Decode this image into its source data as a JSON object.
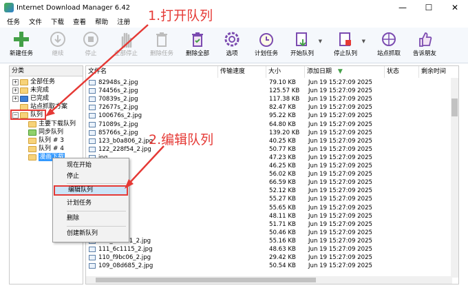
{
  "window": {
    "title": "Internet Download Manager 6.42",
    "minimize": "—",
    "maximize": "☐",
    "close": "✕"
  },
  "menu": [
    "任务",
    "文件",
    "下载",
    "查看",
    "帮助",
    "注册"
  ],
  "toolbar": [
    {
      "label": "新建任务",
      "icon": "plus-icon",
      "enabled": true
    },
    {
      "label": "继续",
      "icon": "down-arrow-icon",
      "enabled": false
    },
    {
      "label": "停止",
      "icon": "stop-icon",
      "enabled": false
    },
    {
      "label": "全部停止",
      "icon": "hand-icon",
      "enabled": false
    },
    {
      "label": "删除任务",
      "icon": "trash-icon",
      "enabled": false
    },
    {
      "label": "删除全部",
      "icon": "trash-all-icon",
      "enabled": true
    },
    {
      "label": "选项",
      "icon": "gear-icon",
      "enabled": true
    },
    {
      "label": "计划任务",
      "icon": "clock-icon",
      "enabled": true
    },
    {
      "label": "开始队列",
      "icon": "start-queue-icon",
      "enabled": true
    },
    {
      "label": "停止队列",
      "icon": "stop-queue-icon",
      "enabled": true
    },
    {
      "label": "站点抓取",
      "icon": "spider-icon",
      "enabled": true
    },
    {
      "label": "告诉朋友",
      "icon": "thumbs-up-icon",
      "enabled": true
    }
  ],
  "annotations": {
    "step1": "1.打开队列",
    "step2": "2.编辑队列"
  },
  "left_pane": {
    "header": "分类",
    "tree": [
      {
        "label": "全部任务",
        "depth": 0,
        "expander": "+",
        "folder": "yellow"
      },
      {
        "label": "未完成",
        "depth": 0,
        "expander": "+",
        "folder": "yellow"
      },
      {
        "label": "已完成",
        "depth": 0,
        "expander": "+",
        "folder": "check"
      },
      {
        "label": "站点抓取方案",
        "depth": 0,
        "expander": "",
        "folder": "yellow"
      },
      {
        "label": "队列",
        "depth": 0,
        "expander": "−",
        "folder": "yellow"
      },
      {
        "label": "主要下载队列",
        "depth": 1,
        "expander": "",
        "folder": "yellow"
      },
      {
        "label": "同步队列",
        "depth": 1,
        "expander": "",
        "folder": "green"
      },
      {
        "label": "队列 # 3",
        "depth": 1,
        "expander": "",
        "folder": "yellow"
      },
      {
        "label": "队列 # 4",
        "depth": 1,
        "expander": "",
        "folder": "yellow"
      },
      {
        "label": "漫画下载",
        "depth": 1,
        "expander": "",
        "folder": "yellow",
        "selected": true
      }
    ]
  },
  "columns": [
    "文件名",
    "传输速度",
    "大小",
    "添加日期",
    "状态",
    "剩余时间"
  ],
  "files": [
    {
      "name": "82948s_2.jpg",
      "size": "79.10  KB",
      "date": "Jun 19 15:27:09 2025"
    },
    {
      "name": "74456s_2.jpg",
      "size": "125.57  KB",
      "date": "Jun 19 15:27:09 2025"
    },
    {
      "name": "70839s_2.jpg",
      "size": "117.38  KB",
      "date": "Jun 19 15:27:09 2025"
    },
    {
      "name": "72677s_2.jpg",
      "size": "82.47  KB",
      "date": "Jun 19 15:27:09 2025"
    },
    {
      "name": "100676s_2.jpg",
      "size": "95.22  KB",
      "date": "Jun 19 15:27:09 2025"
    },
    {
      "name": "71089s_2.jpg",
      "size": "64.80  KB",
      "date": "Jun 19 15:27:09 2025"
    },
    {
      "name": "85766s_2.jpg",
      "size": "139.20  KB",
      "date": "Jun 19 15:27:09 2025"
    },
    {
      "name": "123_b0a806_2.jpg",
      "size": "40.25  KB",
      "date": "Jun 19 15:27:09 2025"
    },
    {
      "name": "122_228f54_2.jpg",
      "size": "50.77  KB",
      "date": "Jun 19 15:27:09 2025"
    },
    {
      "name": "jpg",
      "size": "47.23  KB",
      "date": "Jun 19 15:27:09 2025"
    },
    {
      "name": "jpg",
      "size": "46.25  KB",
      "date": "Jun 19 15:27:09 2025"
    },
    {
      "name": "jpg",
      "size": "56.02  KB",
      "date": "Jun 19 15:27:09 2025"
    },
    {
      "name": "jpg",
      "size": "66.59  KB",
      "date": "Jun 19 15:27:09 2025"
    },
    {
      "name": "2.jpg",
      "size": "52.12  KB",
      "date": "Jun 19 15:27:09 2025"
    },
    {
      "name": "2.jpg",
      "size": "55.27  KB",
      "date": "Jun 19 15:27:09 2025"
    },
    {
      "name": "2.jpg",
      "size": "55.65  KB",
      "date": "Jun 19 15:27:09 2025"
    },
    {
      "name": "2.jpg",
      "size": "48.11  KB",
      "date": "Jun 19 15:27:09 2025"
    },
    {
      "name": "2.jpg",
      "size": "51.71  KB",
      "date": "Jun 19 15:27:09 2025"
    },
    {
      "name": "2.jpg",
      "size": "50.46  KB",
      "date": "Jun 19 15:27:09 2025"
    },
    {
      "name": "112_489fc1_2.jpg",
      "size": "55.16  KB",
      "date": "Jun 19 15:27:09 2025"
    },
    {
      "name": "111_6c1115_2.jpg",
      "size": "48.63  KB",
      "date": "Jun 19 15:27:09 2025"
    },
    {
      "name": "110_f9bc06_2.jpg",
      "size": "29.42  KB",
      "date": "Jun 19 15:27:09 2025"
    },
    {
      "name": "109_08d685_2.jpg",
      "size": "50.54  KB",
      "date": "Jun 19 15:27:09 2025"
    }
  ],
  "context_menu": [
    {
      "label": "现在开始",
      "enabled": true
    },
    {
      "label": "停止",
      "enabled": true
    },
    {
      "label": "编辑队列",
      "enabled": true,
      "highlight": true
    },
    {
      "label": "计划任务",
      "enabled": true
    },
    {
      "label": "删除",
      "enabled": true
    },
    {
      "label": "创建新队列",
      "enabled": true
    }
  ],
  "colors": {
    "accent_red": "#e53935",
    "selection": "#cce4f7",
    "tree_selected": "#3399ff"
  }
}
